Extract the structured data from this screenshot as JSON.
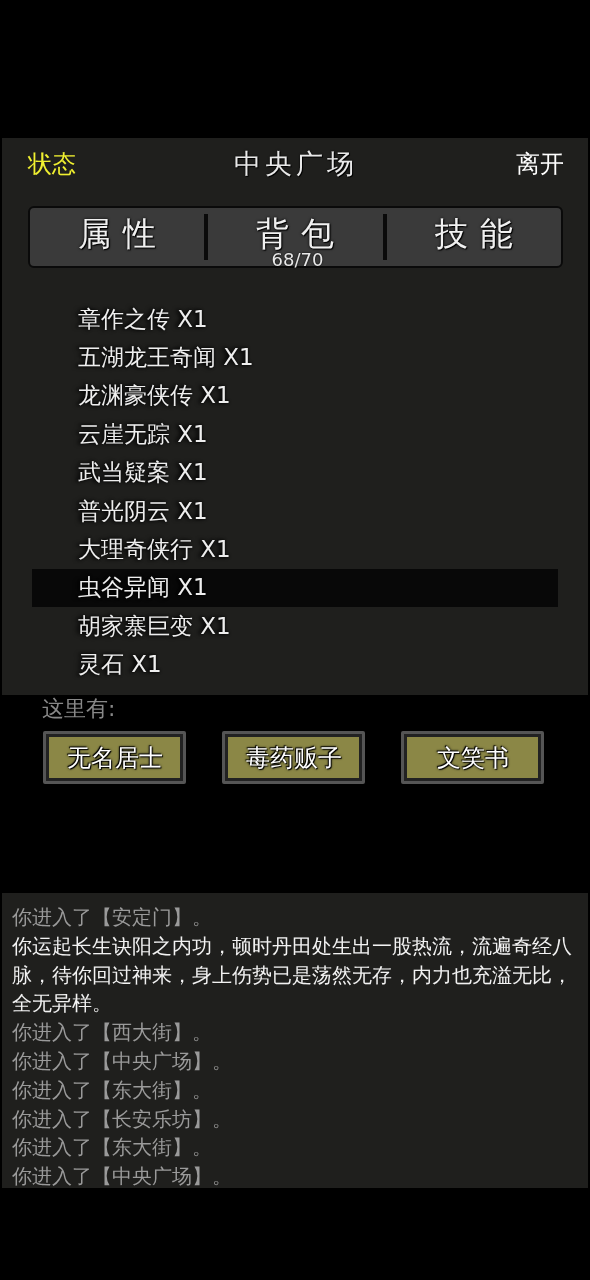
{
  "header": {
    "status": "状态",
    "title": "中央广场",
    "leave": "离开"
  },
  "tabs": [
    {
      "label": "属性"
    },
    {
      "label": "背包",
      "count": "68/70"
    },
    {
      "label": "技能"
    }
  ],
  "items": [
    {
      "label": "章作之传 X1",
      "selected": false
    },
    {
      "label": "五湖龙王奇闻 X1",
      "selected": false
    },
    {
      "label": "龙渊豪侠传 X1",
      "selected": false
    },
    {
      "label": "云崖无踪 X1",
      "selected": false
    },
    {
      "label": "武当疑案 X1",
      "selected": false
    },
    {
      "label": "普光阴云 X1",
      "selected": false
    },
    {
      "label": "大理奇侠行 X1",
      "selected": false
    },
    {
      "label": "虫谷异闻 X1",
      "selected": true
    },
    {
      "label": "胡家寨巨变 X1",
      "selected": false
    },
    {
      "label": "灵石 X1",
      "selected": false
    }
  ],
  "here": {
    "label": "这里有:",
    "npcs": [
      "无名居士",
      "毒药贩子",
      "文笑书"
    ]
  },
  "log": [
    {
      "kind": "system",
      "text": "你进入了【安定门】。"
    },
    {
      "kind": "message",
      "text": "你运起长生诀阳之内功，顿时丹田处生出一股热流，流遍奇经八脉，待你回过神来，身上伤势已是荡然无存，内力也充溢无比，全无异样。"
    },
    {
      "kind": "system",
      "text": "你进入了【西大街】。"
    },
    {
      "kind": "system",
      "text": "你进入了【中央广场】。"
    },
    {
      "kind": "system",
      "text": "你进入了【东大街】。"
    },
    {
      "kind": "system",
      "text": "你进入了【长安乐坊】。"
    },
    {
      "kind": "system",
      "text": "你进入了【东大街】。"
    },
    {
      "kind": "system",
      "text": "你进入了【中央广场】。"
    }
  ]
}
